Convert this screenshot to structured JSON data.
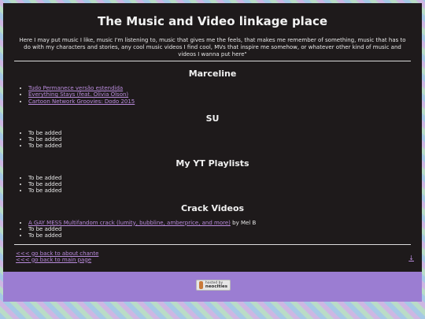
{
  "page": {
    "title": "The Music and Video linkage place",
    "intro": "Here I may put music I like, music I'm listening to, music that gives me the feels, that makes me remember of something, music that has to do with my characters and stories, any cool music videos I find cool, MVs that inspire me somehow, or whatever other kind of music and videos I wanna put here\""
  },
  "sections": {
    "marceline": {
      "heading": "Marceline",
      "items": [
        "Tudo Permanece versão estendida",
        "Everything Stays (feat. Olivia Olson)",
        "Cartoon Network Groovies: Dodo 2015"
      ]
    },
    "su": {
      "heading": "SU",
      "items": [
        "To be added",
        "To be added",
        "To be added"
      ]
    },
    "yt": {
      "heading": "My YT Playlists",
      "items": [
        "To be added",
        "To be added",
        "To be added"
      ]
    },
    "crack": {
      "heading": "Crack Videos",
      "link": "A GAY MESS Multifandom crack (lumity, bubbline, amberprice, and more)",
      "link_suffix": " by Mel B",
      "items": [
        "To be added",
        "To be added"
      ]
    }
  },
  "nav": {
    "back_about": "<<< go back to about chante",
    "back_main": "<<< go back to main page",
    "arrow": "↓"
  },
  "footer": {
    "badge_top": "hosted by",
    "badge_name": "neocities"
  }
}
